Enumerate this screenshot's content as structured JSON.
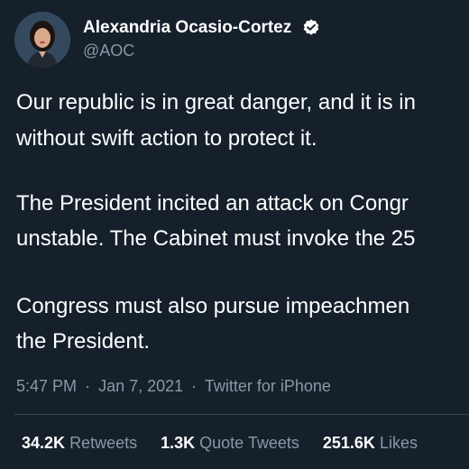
{
  "author": {
    "name": "Alexandria Ocasio-Cortez",
    "handle": "@AOC",
    "verified_icon": "verified-badge-icon",
    "avatar_icon": "avatar-photo"
  },
  "tweet": {
    "lines": [
      "Our republic is in great danger, and it is in",
      "without swift action to protect it.",
      "The President incited an attack on Congr",
      "unstable. The Cabinet must invoke the 25",
      "Congress must also pursue impeachmen",
      "the President."
    ]
  },
  "meta": {
    "time": "5:47 PM",
    "separator1": "·",
    "date": "Jan 7, 2021",
    "separator2": "·",
    "source": "Twitter for iPhone"
  },
  "stats": {
    "retweets_count": "34.2K",
    "retweets_label": "Retweets",
    "quotes_count": "1.3K",
    "quotes_label": "Quote Tweets",
    "likes_count": "251.6K",
    "likes_label": "Likes"
  },
  "colors": {
    "background": "#15202b",
    "primary_text": "#ffffff",
    "secondary_text": "#8899a6",
    "divider": "#38444d"
  }
}
